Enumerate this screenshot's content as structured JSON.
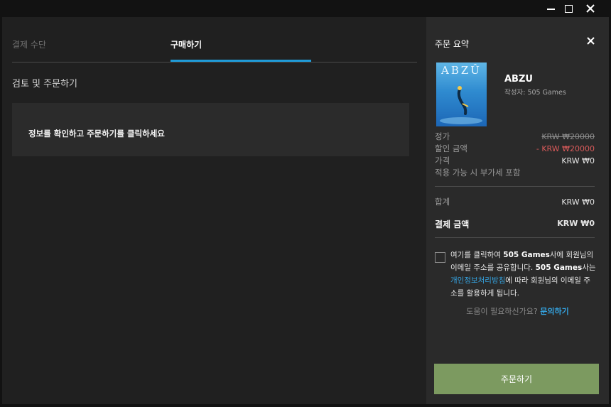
{
  "window": {
    "controls": {
      "minimize_icon": "minimize-icon",
      "maximize_icon": "maximize-icon",
      "close_icon": "close-icon"
    }
  },
  "tabs": {
    "payment_label": "결제 수단",
    "purchase_label": "구매하기",
    "active_color": "#1f9bd8"
  },
  "review": {
    "title": "검토 및 주문하기",
    "notice": "정보를 확인하고 주문하기를 클릭하세요"
  },
  "summary": {
    "title": "주문 요약",
    "game": {
      "name": "ABZU",
      "developer": "작성자: 505 Games",
      "image_logo": "ABZÛ"
    },
    "rows": {
      "price_label": "정가",
      "price_value": "KRW ₩20000",
      "discount_label": "할인 금액",
      "discount_value": "- KRW ₩20000",
      "final_label": "가격",
      "final_value": "KRW ₩0",
      "vat_note": "적용 가능 시 부가세 포함",
      "subtotal_label": "합계",
      "subtotal_value": "KRW ₩0",
      "total_label": "결제 금액",
      "total_value": "KRW ₩0"
    },
    "consent": {
      "part1": "여기를 클릭하여 ",
      "brand1": "505 Games",
      "part2": "사에 회원님의 이메일 주소를 공유합니다. ",
      "brand2": "505 Games",
      "part3": "사는 ",
      "policy_link": "개인정보처리방침",
      "part4": "에 따라 회원님의 이메일 주소를 활용하게 됩니다."
    },
    "help": {
      "text": "도움이 필요하신가요? ",
      "link": "문의하기"
    },
    "order_button": "주문하기",
    "discount_color": "#d95a5a",
    "button_color": "#7c9a60"
  }
}
